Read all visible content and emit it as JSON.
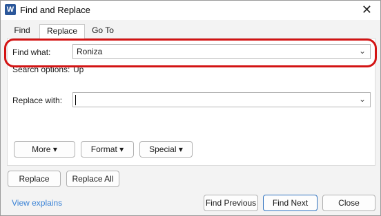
{
  "window": {
    "title": "Find and Replace",
    "app_icon_letter": "W"
  },
  "tabs": [
    {
      "label": "Find"
    },
    {
      "label": "Replace",
      "selected": true
    },
    {
      "label": "Go To"
    }
  ],
  "find": {
    "label": "Find what:",
    "value": "Roniza"
  },
  "search_options": {
    "label": "Search options:",
    "value": "Up"
  },
  "replace": {
    "label": "Replace with:",
    "value": ""
  },
  "options_buttons": {
    "more": "More",
    "format": "Format",
    "special": "Special"
  },
  "actions": {
    "replace": "Replace",
    "replace_all": "Replace All"
  },
  "footer": {
    "link": "View explains",
    "find_previous": "Find Previous",
    "find_next": "Find Next",
    "close": "Close"
  },
  "colors": {
    "highlight": "#d31313",
    "link": "#3b83d6",
    "primary_border": "#2a6fbd"
  }
}
